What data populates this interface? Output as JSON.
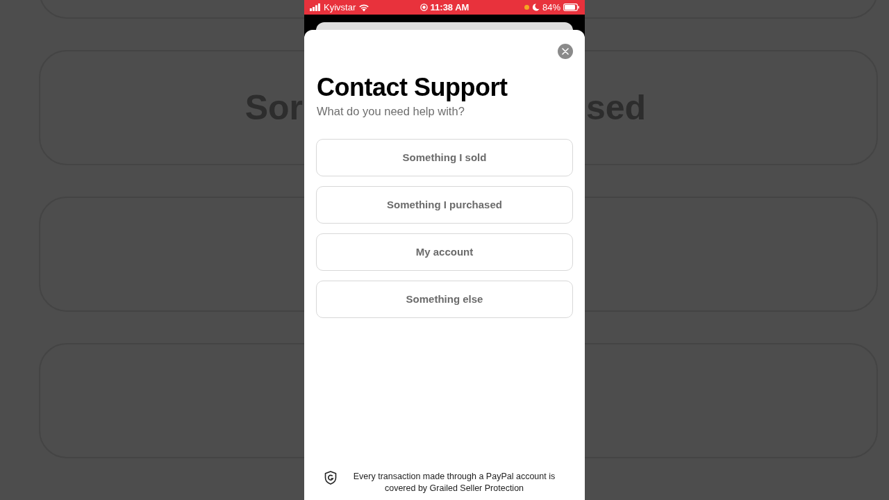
{
  "background_texts": [
    "Sor",
    "sed"
  ],
  "status_bar": {
    "carrier": "Kyivstar",
    "time": "11:38 AM",
    "battery": "84%"
  },
  "sheet": {
    "title": "Contact Support",
    "subtitle": "What do you need help with?",
    "options": [
      {
        "label": "Something I sold"
      },
      {
        "label": "Something I purchased"
      },
      {
        "label": "My account"
      },
      {
        "label": "Something else"
      }
    ],
    "footer": "Every transaction made through a PayPal account is covered by Grailed Seller Protection"
  }
}
